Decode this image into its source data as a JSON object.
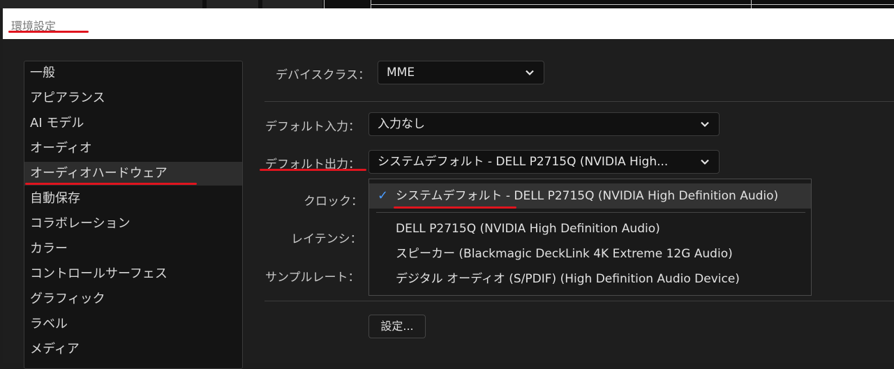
{
  "window": {
    "title": "環境設定"
  },
  "sidebar": {
    "items": [
      {
        "label": "一般"
      },
      {
        "label": "アピアランス"
      },
      {
        "label": "AI モデル"
      },
      {
        "label": "オーディオ"
      },
      {
        "label": "オーディオハードウェア",
        "selected": true
      },
      {
        "label": "自動保存"
      },
      {
        "label": "コラボレーション"
      },
      {
        "label": "カラー"
      },
      {
        "label": "コントロールサーフェス"
      },
      {
        "label": "グラフィック"
      },
      {
        "label": "ラベル"
      },
      {
        "label": "メディア"
      }
    ]
  },
  "main": {
    "device_class": {
      "label": "デバイスクラス：",
      "value": "MME"
    },
    "default_input": {
      "label": "デフォルト入力：",
      "value": "入力なし"
    },
    "default_output": {
      "label": "デフォルト出力：",
      "value": "システムデフォルト - DELL P2715Q (NVIDIA High..."
    },
    "clock": {
      "label": "クロック："
    },
    "latency": {
      "label": "レイテンシ："
    },
    "sample_rate": {
      "label": "サンプルレート："
    },
    "settings_button": "設定..."
  },
  "output_popup": {
    "options": [
      {
        "label": "システムデフォルト - DELL P2715Q (NVIDIA High Definition Audio)",
        "checked": true
      },
      {
        "label": "DELL P2715Q (NVIDIA High Definition Audio)"
      },
      {
        "label": "スピーカー (Blackmagic DeckLink 4K Extreme 12G Audio)"
      },
      {
        "label": "デジタル オーディオ (S/PDIF) (High Definition Audio Device)"
      }
    ],
    "check_glyph": "✓"
  },
  "colors": {
    "accent": "#4a9cff",
    "annotation_red": "#e0141e"
  },
  "icons": {
    "dropdown": "chevron-down-icon",
    "selected": "checkmark-icon"
  }
}
